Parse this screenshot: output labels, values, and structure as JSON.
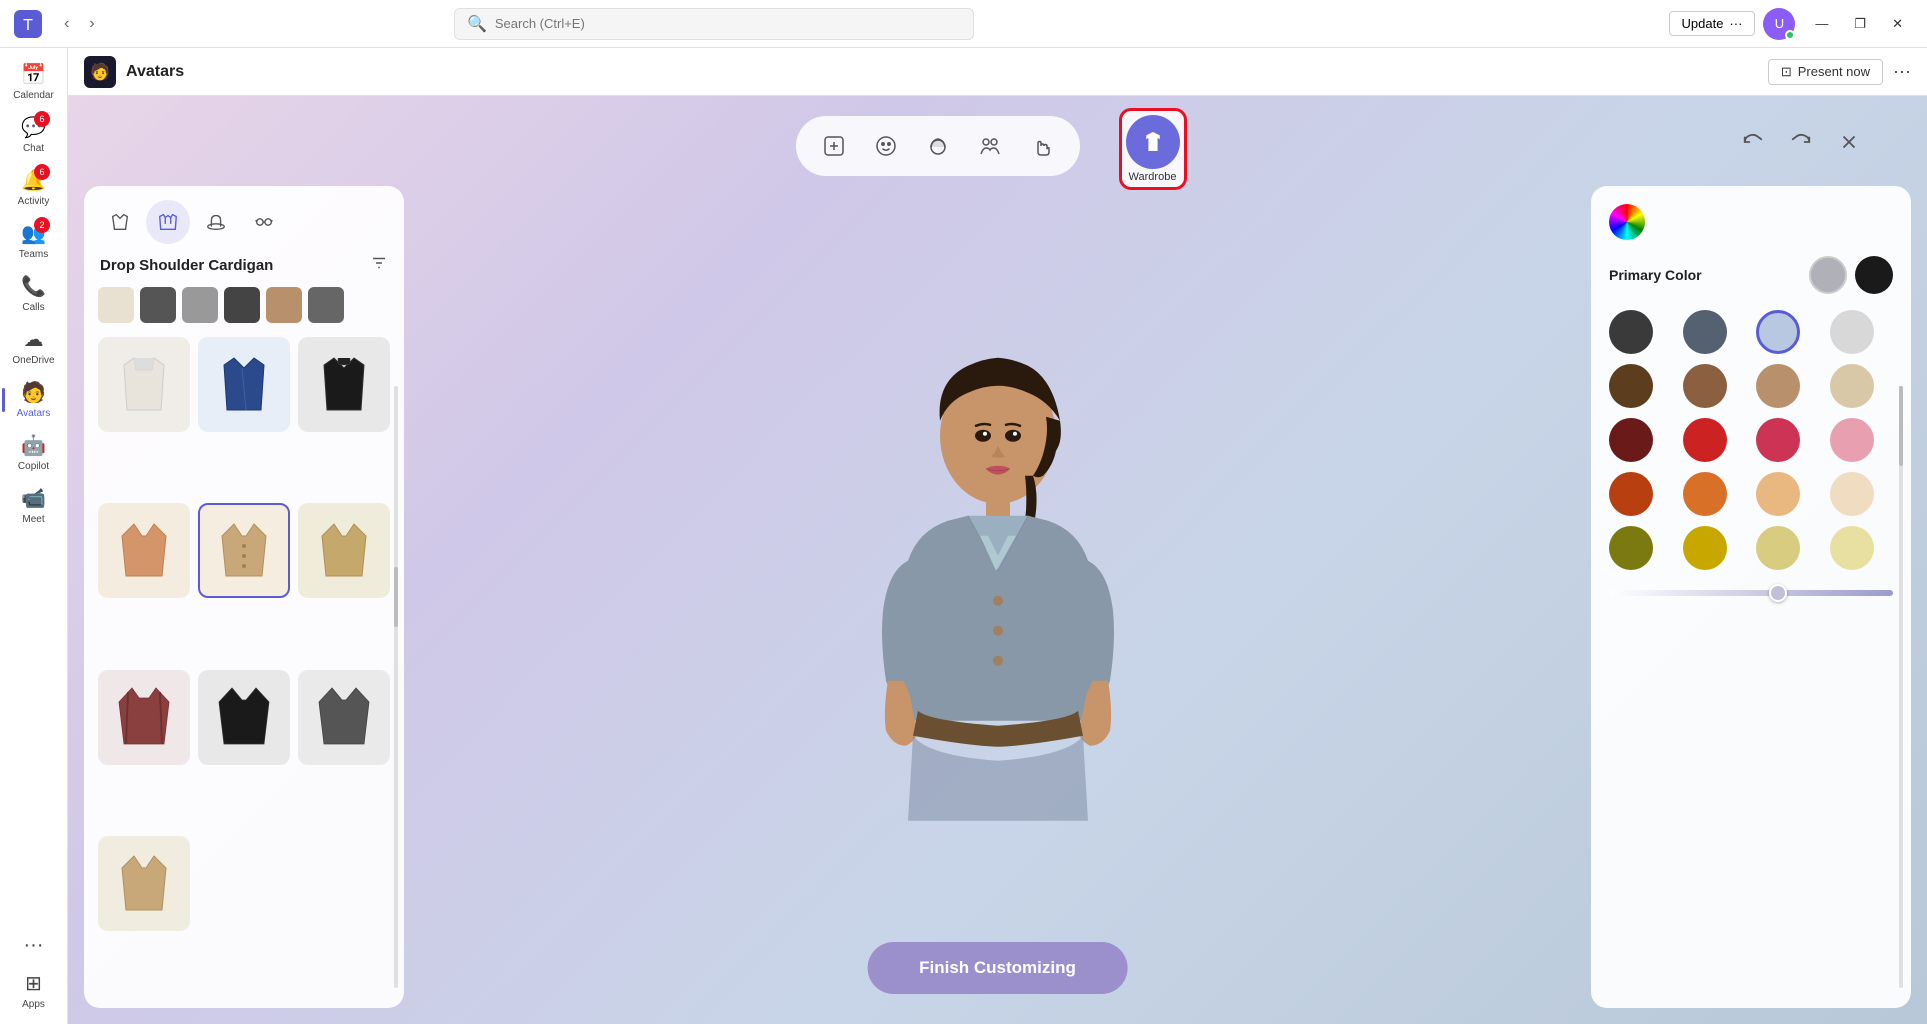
{
  "titlebar": {
    "app_name": "Microsoft Teams",
    "search_placeholder": "Search (Ctrl+E)",
    "update_label": "Update",
    "more_label": "···",
    "minimize": "—",
    "maximize": "❐",
    "close": "✕"
  },
  "sidebar": {
    "items": [
      {
        "id": "calendar",
        "label": "Calendar",
        "icon": "📅",
        "badge": null
      },
      {
        "id": "chat",
        "label": "Chat",
        "icon": "💬",
        "badge": "6"
      },
      {
        "id": "activity",
        "label": "Activity",
        "icon": "🔔",
        "badge": "6"
      },
      {
        "id": "teams",
        "label": "Teams",
        "icon": "👥",
        "badge": "2"
      },
      {
        "id": "calls",
        "label": "Calls",
        "icon": "📞",
        "badge": null
      },
      {
        "id": "onedrive",
        "label": "OneDrive",
        "icon": "☁",
        "badge": null
      },
      {
        "id": "avatars",
        "label": "Avatars",
        "icon": "🧑",
        "badge": null,
        "active": true
      },
      {
        "id": "copilot",
        "label": "Copilot",
        "icon": "🤖",
        "badge": null
      },
      {
        "id": "meet",
        "label": "Meet",
        "icon": "📹",
        "badge": null
      },
      {
        "id": "more",
        "label": "···",
        "icon": "···",
        "badge": null
      },
      {
        "id": "apps",
        "label": "Apps",
        "icon": "⊞",
        "badge": null
      }
    ]
  },
  "page_header": {
    "icon": "🧑",
    "title": "Avatars",
    "present_now": "Present now",
    "more": "···"
  },
  "toolbar": {
    "buttons": [
      {
        "id": "avatar-select",
        "icon": "🖼",
        "label": "Avatar Select"
      },
      {
        "id": "face",
        "icon": "😊",
        "label": "Face"
      },
      {
        "id": "hair",
        "icon": "🪢",
        "label": "Hair"
      },
      {
        "id": "group",
        "icon": "👥",
        "label": "Group"
      },
      {
        "id": "gesture",
        "icon": "🤙",
        "label": "Gesture"
      },
      {
        "id": "wardrobe",
        "icon": "👕",
        "label": "Wardrobe",
        "active": true
      }
    ],
    "undo": "↺",
    "redo": "↻",
    "close": "✕"
  },
  "wardrobe_panel": {
    "tabs": [
      {
        "id": "top",
        "icon": "👔",
        "active": false
      },
      {
        "id": "jacket",
        "icon": "🧥",
        "active": true
      },
      {
        "id": "hat",
        "icon": "🎩",
        "active": false
      },
      {
        "id": "glasses",
        "icon": "👓",
        "active": false
      }
    ],
    "section_title": "Drop Shoulder Cardigan",
    "items": [
      {
        "color": "#e8e0d0",
        "emoji": "🧥"
      },
      {
        "color": "#2a4a8c",
        "emoji": "🧥"
      },
      {
        "color": "#1a1a1a",
        "emoji": "🧥"
      },
      {
        "color": "#d4956a",
        "emoji": "🧥"
      },
      {
        "color": "#c8a878",
        "emoji": "🧥",
        "selected": true
      },
      {
        "color": "#c4a86c",
        "emoji": "🧥"
      },
      {
        "color": "#8b4040",
        "emoji": "🧥"
      },
      {
        "color": "#1a1a1a",
        "emoji": "🧥"
      },
      {
        "color": "#555",
        "emoji": "🧥"
      },
      {
        "color": "#c8a878",
        "emoji": "🧥"
      }
    ]
  },
  "color_panel": {
    "title": "Primary Color",
    "top_swatches": [
      {
        "color": "#b0b0b8",
        "selected": false
      },
      {
        "color": "#1a1a1a",
        "selected": false
      }
    ],
    "colors": [
      {
        "color": "#3a3a3a",
        "selected": false
      },
      {
        "color": "#556070",
        "selected": false
      },
      {
        "color": "#b8c8e0",
        "selected": true
      },
      {
        "color": "#d8d8d8",
        "selected": false
      },
      {
        "color": "#5c3d1e",
        "selected": false
      },
      {
        "color": "#8b6040",
        "selected": false
      },
      {
        "color": "#b8906c",
        "selected": false
      },
      {
        "color": "#d8c8a8",
        "selected": false
      },
      {
        "color": "#6b1a1a",
        "selected": false
      },
      {
        "color": "#cc2222",
        "selected": false
      },
      {
        "color": "#cc3355",
        "selected": false
      },
      {
        "color": "#e8a0b0",
        "selected": false
      },
      {
        "color": "#b84010",
        "selected": false
      },
      {
        "color": "#d87028",
        "selected": false
      },
      {
        "color": "#e8b880",
        "selected": false
      },
      {
        "color": "#f0dcc0",
        "selected": false
      },
      {
        "color": "#7a7a10",
        "selected": false
      },
      {
        "color": "#c8a800",
        "selected": false
      },
      {
        "color": "#d8cc80",
        "selected": false
      },
      {
        "color": "#e8e0a0",
        "selected": false
      }
    ],
    "slider_value": 60
  },
  "finish_button": {
    "label": "Finish Customizing"
  }
}
